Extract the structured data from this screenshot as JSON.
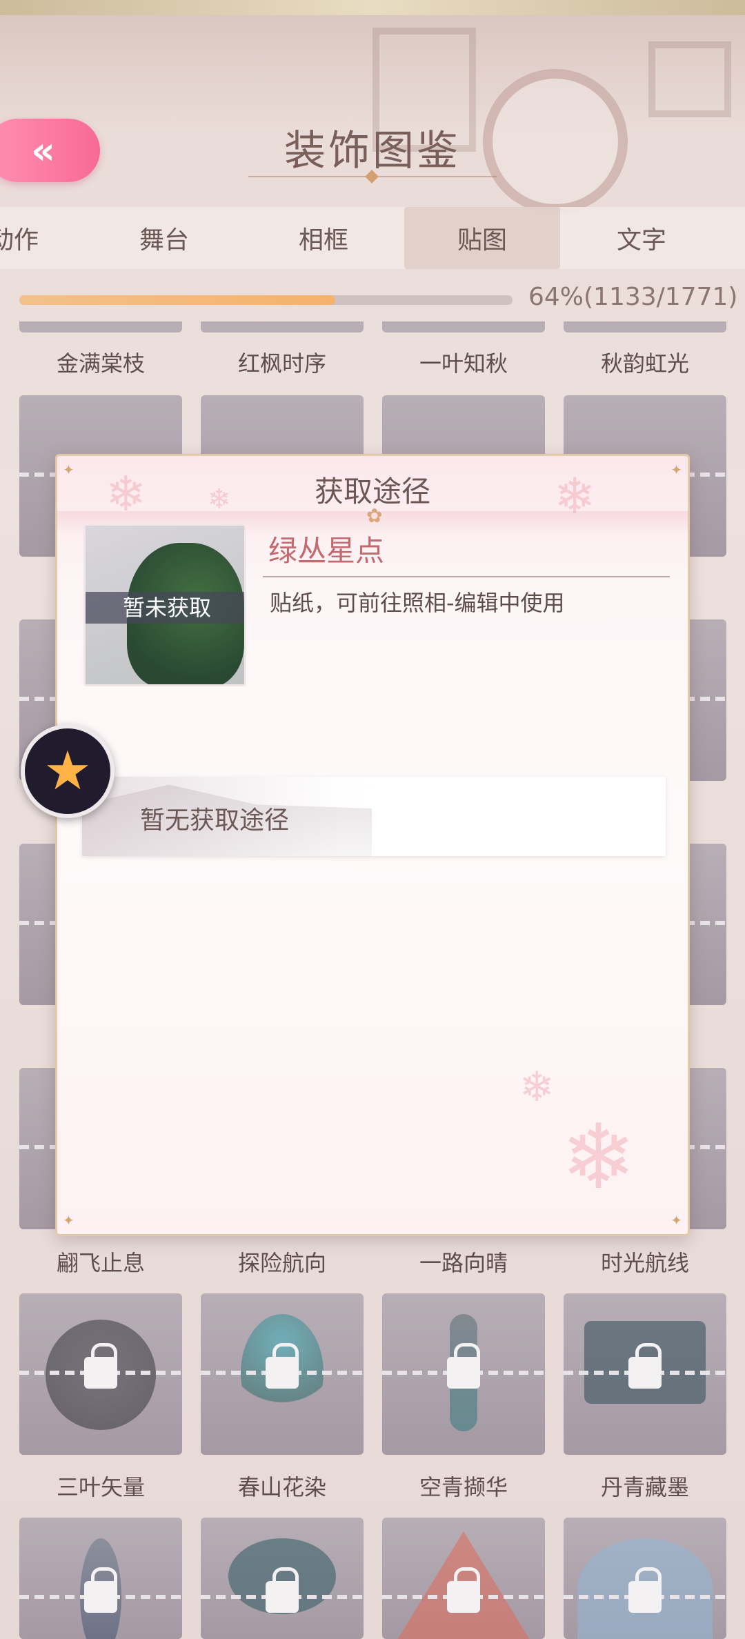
{
  "header": {
    "title": "装饰图鉴",
    "back_icon": "double-chevron-left-icon"
  },
  "tabs": [
    {
      "label": "动作",
      "active": false
    },
    {
      "label": "舞台",
      "active": false
    },
    {
      "label": "相框",
      "active": false
    },
    {
      "label": "贴图",
      "active": true
    },
    {
      "label": "文字",
      "active": false
    }
  ],
  "progress": {
    "value": 0.64,
    "label": "64%(1133/1771)"
  },
  "grid": {
    "row1_labels": [
      "金满棠枝",
      "红枫时序",
      "一叶知秋",
      "秋韵虹光"
    ],
    "row2_labels": [
      "翩飞止息",
      "探险航向",
      "一路向晴",
      "时光航线"
    ],
    "row3_labels": [
      "三叶矢量",
      "春山花染",
      "空青撷华",
      "丹青藏墨"
    ],
    "lock_icon": "padlock-icon"
  },
  "modal": {
    "title": "获取途径",
    "item_name": "绿丛星点",
    "item_desc": "贴纸，可前往照相-编辑中使用",
    "status_banner": "暂未获取",
    "source_text": "暂无获取途径"
  },
  "floating_button": {
    "icon": "star-app-icon"
  },
  "colors": {
    "accent_pink": "#f86a96",
    "progress_fill": "#f5b26b",
    "item_name": "#c26a6f"
  }
}
